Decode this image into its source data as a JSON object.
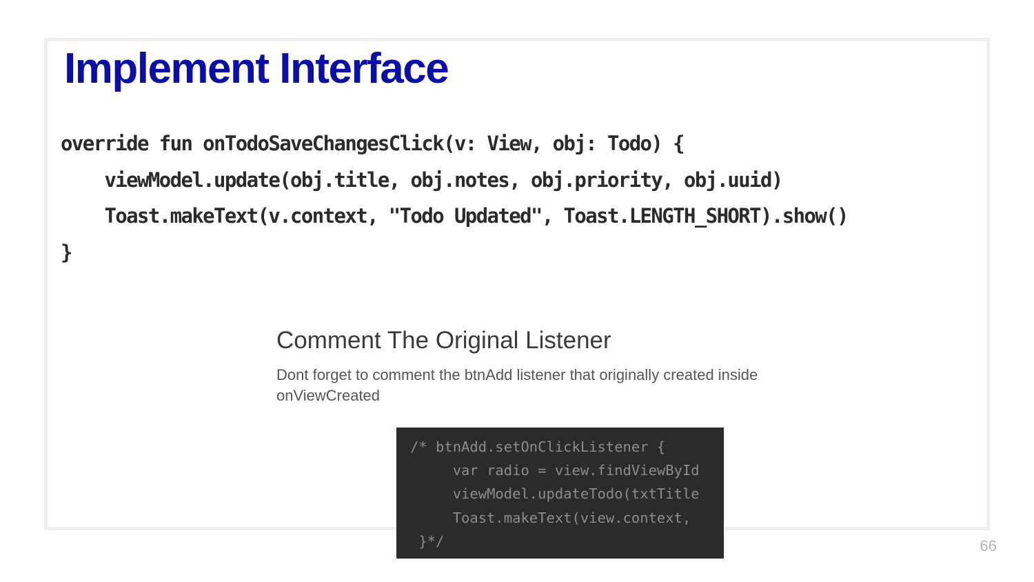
{
  "slide": {
    "title": "Implement Interface",
    "code_lines": [
      "override fun onTodoSaveChangesClick(v: View, obj: Todo) {",
      "    viewModel.update(obj.title, obj.notes, obj.priority, obj.uuid)",
      "    Toast.makeText(v.context, \"Todo Updated\", Toast.LENGTH_SHORT).show()",
      "}"
    ],
    "section_heading": "Comment The Original Listener",
    "section_description": "Dont forget to comment the btnAdd listener that originally created inside onViewCreated",
    "snippet_lines": [
      "/* btnAdd.setOnClickListener {",
      "     var radio = view.findViewById",
      "     viewModel.updateTodo(txtTitle",
      "     Toast.makeText(view.context, ",
      " }*/"
    ],
    "page_number": "66"
  },
  "colors": {
    "title": "#0a0fa8",
    "code_text": "#2b2b2b",
    "snippet_background": "#2b2b2b",
    "snippet_text": "#8c8c8c",
    "frame_border": "#efefef"
  }
}
